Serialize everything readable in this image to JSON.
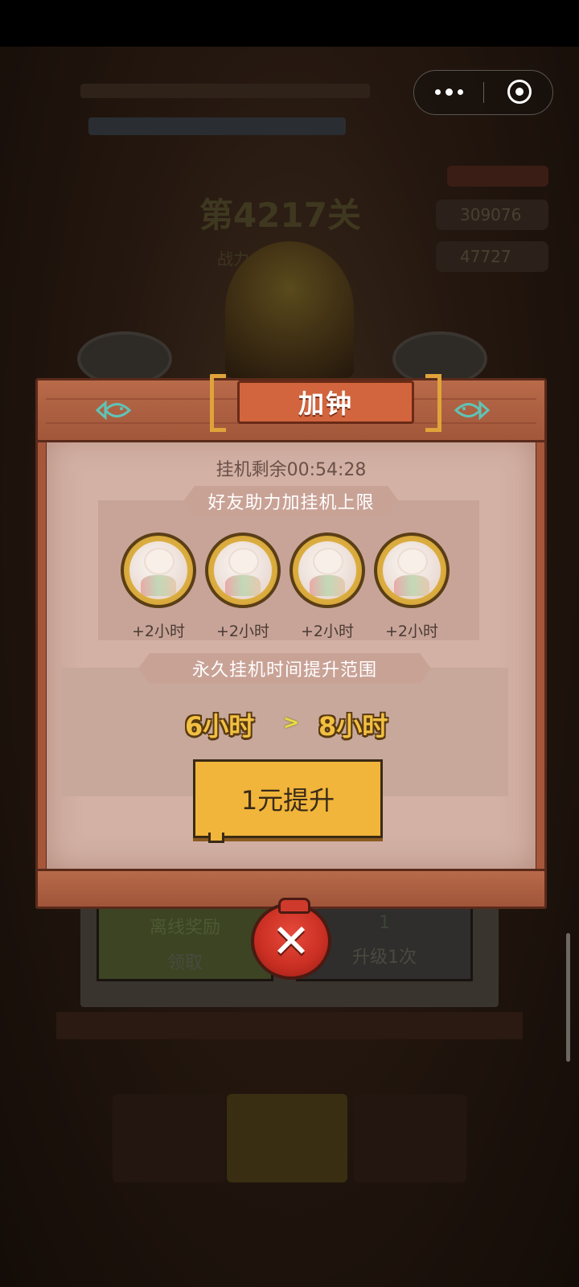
{
  "background": {
    "level_text": "第4217关",
    "power_text": "战力 万",
    "resource_1": "309076",
    "resource_2": "47727",
    "offline_reward_label": "离线奖励",
    "claim_label": "领取",
    "upgrade_count": "1",
    "upgrade_once_label": "升级1次"
  },
  "dialog": {
    "title": "加钟",
    "idle_remaining": "挂机剩余00:54:28",
    "friends_section_title": "好友助力加挂机上限",
    "friends": [
      {
        "bonus": "+2小时"
      },
      {
        "bonus": "+2小时"
      },
      {
        "bonus": "+2小时"
      },
      {
        "bonus": "+2小时"
      }
    ],
    "perm_section_title": "永久挂机时间提升范围",
    "from_hours": "6小时",
    "arrow": ">",
    "to_hours": "8小时",
    "upgrade_button": "1元提升",
    "close_symbol": "✕"
  },
  "colors": {
    "accent_gold": "#f0b53a",
    "frame_wood": "#b86a49",
    "title_plank": "#d2653d",
    "close_red": "#d93626",
    "content_bg": "#d3b1a5"
  }
}
